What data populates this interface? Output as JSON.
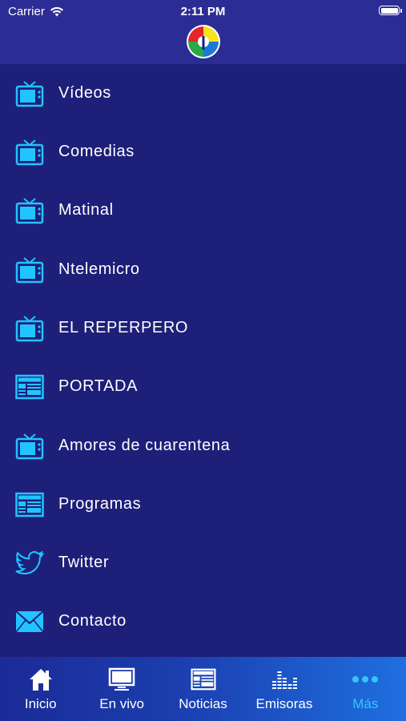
{
  "status": {
    "carrier": "Carrier",
    "time": "2:11 PM"
  },
  "colors": {
    "background": "#1e1f79",
    "header": "#2c2d94",
    "icon_accent": "#22c4ff",
    "active_tab": "#36c5ff"
  },
  "menu": {
    "items": [
      {
        "label": "Vídeos",
        "icon": "tv-icon"
      },
      {
        "label": "Comedias",
        "icon": "tv-icon"
      },
      {
        "label": "Matinal",
        "icon": "tv-icon"
      },
      {
        "label": "Ntelemicro",
        "icon": "tv-icon"
      },
      {
        "label": "EL REPERPERO",
        "icon": "tv-icon"
      },
      {
        "label": "PORTADA",
        "icon": "newspaper-icon"
      },
      {
        "label": "Amores de cuarentena",
        "icon": "tv-icon"
      },
      {
        "label": "Programas",
        "icon": "newspaper-icon"
      },
      {
        "label": "Twitter",
        "icon": "twitter-bird-icon"
      },
      {
        "label": "Contacto",
        "icon": "envelope-icon"
      }
    ]
  },
  "tabbar": {
    "tabs": [
      {
        "label": "Inicio",
        "icon": "home-icon"
      },
      {
        "label": "En vivo",
        "icon": "monitor-icon"
      },
      {
        "label": "Noticias",
        "icon": "newspaper-icon"
      },
      {
        "label": "Emisoras",
        "icon": "equalizer-icon"
      },
      {
        "label": "Más",
        "icon": "more-dots-icon",
        "active": true
      }
    ]
  }
}
